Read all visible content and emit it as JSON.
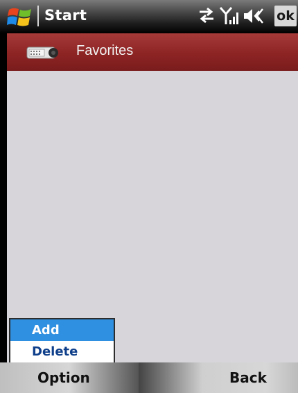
{
  "titlebar": {
    "title": "Start",
    "ok_label": "ok",
    "icons": [
      "windows-start-icon",
      "connectivity-icon",
      "signal-strength-icon",
      "volume-icon"
    ]
  },
  "header": {
    "title": "Favorites",
    "icon": "device-icon"
  },
  "menu": {
    "items": [
      {
        "label": "Add",
        "selected": true
      },
      {
        "label": "Delete",
        "selected": false
      }
    ]
  },
  "softkeys": {
    "left": "Option",
    "right": "Back"
  },
  "colors": {
    "header": "#8d2424",
    "content": "#d7d5d9",
    "menu_selected": "#2f8fe0",
    "menu_text": "#0f3f8a"
  }
}
